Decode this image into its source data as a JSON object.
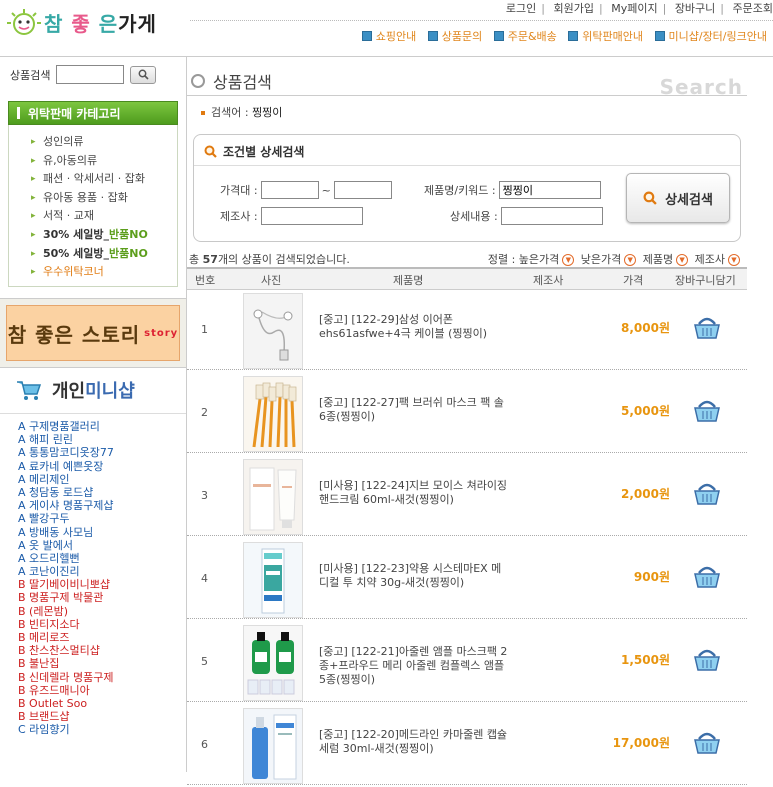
{
  "logo": {
    "text_a": "참",
    "text_b": "좋",
    "text_c": "은",
    "text_d": "가게"
  },
  "topnav": [
    "로그인",
    "회원가입",
    "My페이지",
    "장바구니",
    "주문조회"
  ],
  "menu": [
    "쇼핑안내",
    "상품문의",
    "주문&배송",
    "위탁판매안내",
    "미니샵/장터/링크안내"
  ],
  "sidebar": {
    "search_label": "상품검색",
    "category_title": "위탁판매 카테고리",
    "categories": [
      {
        "label": "성인의류"
      },
      {
        "label": "유,아동의류"
      },
      {
        "label": "패션 · 악세서리 · 잡화"
      },
      {
        "label": "유아동 용품 · 잡화"
      },
      {
        "label": "서적 · 교재"
      },
      {
        "label": "30% 세일방_",
        "tag": "반품NO"
      },
      {
        "label": "50% 세일방_",
        "tag": "반품NO"
      },
      {
        "label": "우수위탁코너"
      }
    ],
    "banner_text": "참 좋은 스토리",
    "banner_sub": "story",
    "mini_title_a": "개인",
    "mini_title_b": "미니샵",
    "mini_items": [
      {
        "t": "a",
        "label": "A 구제명품갤러리"
      },
      {
        "t": "a",
        "label": "A 해피 린린"
      },
      {
        "t": "a",
        "label": "A 통통맘코디옷장77"
      },
      {
        "t": "a",
        "label": "A 료카네 예쁜옷장"
      },
      {
        "t": "a",
        "label": "A 메리제인"
      },
      {
        "t": "a",
        "label": "A 청담동 로드샵"
      },
      {
        "t": "a",
        "label": "A 게이샤 명품구제샵"
      },
      {
        "t": "a",
        "label": "A 빨강구두"
      },
      {
        "t": "a",
        "label": "A 방배동 사모님"
      },
      {
        "t": "a",
        "label": "A 옷 발에서"
      },
      {
        "t": "a",
        "label": "A 오드리헬뻔"
      },
      {
        "t": "a",
        "label": "A 코난이진리"
      },
      {
        "t": "b",
        "label": "B 딸기베이비니뽀샵"
      },
      {
        "t": "b",
        "label": "B 명품구제 박물관"
      },
      {
        "t": "b",
        "label": "B (레몬밤)"
      },
      {
        "t": "b",
        "label": "B 빈티지소다"
      },
      {
        "t": "b",
        "label": "B 메리로즈"
      },
      {
        "t": "b",
        "label": "B 찬스찬스멀티샵"
      },
      {
        "t": "b",
        "label": "B 불난집"
      },
      {
        "t": "b",
        "label": "B 신데렐라 명품구제"
      },
      {
        "t": "b",
        "label": "B 유즈드매니아"
      },
      {
        "t": "b",
        "label": "B Outlet Soo"
      },
      {
        "t": "b",
        "label": "B 브랜드샵"
      },
      {
        "t": "a",
        "label": "C 라임향기"
      }
    ]
  },
  "main": {
    "title": "상품검색",
    "title_en": "Search",
    "keyword_label": "검색어 :",
    "keyword": "찡찡이",
    "cond_title": "조건별 상세검색",
    "price_label": "가격대 :",
    "tilde": "~",
    "name_label": "제품명/키워드 :",
    "name_value": "찡찡이",
    "maker_label": "제조사 :",
    "detail_label": "상세내용 :",
    "detail_button": "상세검색",
    "count_prefix": "총 ",
    "count": "57",
    "count_suffix": "개의 상품이 검색되었습니다.",
    "sort_label": "정렬 :",
    "sort_options": [
      "높은가격",
      "낮은가격",
      "제품명",
      "제조사"
    ],
    "columns": [
      "번호",
      "사진",
      "제품명",
      "제조사",
      "가격",
      "장바구니담기"
    ],
    "products": [
      {
        "no": "1",
        "name": "[중고] [122-29]삼성 이어폰 ehs61asfwe+4극 케이블 (찡찡이)",
        "price": "8,000원",
        "kind": "earphone"
      },
      {
        "no": "2",
        "name": "[중고] [122-27]팩 브러쉬 마스크 팩 솔6종(찡찡이)",
        "price": "5,000원",
        "kind": "brush"
      },
      {
        "no": "3",
        "name": "[미사용] [122-24]지브 모이스 쳐라이징 핸드크림 60ml-새것(찡찡이)",
        "price": "2,000원",
        "kind": "cream"
      },
      {
        "no": "4",
        "name": "[미사용] [122-23]약용 시스테마EX 메디컬 투 치약 30g-새것(찡찡이)",
        "price": "900원",
        "kind": "toothpaste"
      },
      {
        "no": "5",
        "name": "[중고] [122-21]아줄렌 앰플 마스크팩 2종+프라우드 메리 아줄렌 컴플렉스 앰플 5종(찡찡이)",
        "price": "1,500원",
        "kind": "ampoule"
      },
      {
        "no": "6",
        "name": "[중고] [122-20]메드라인 카마줄렌 캡슐 세럼 30ml-새것(찡찡이)",
        "price": "17,000원",
        "kind": "serum"
      }
    ]
  },
  "colors": {
    "accent_green": "#5c9e1c",
    "price_orange": "#e8950f",
    "link_blue": "#1a5aa8",
    "link_red": "#cc2020"
  }
}
